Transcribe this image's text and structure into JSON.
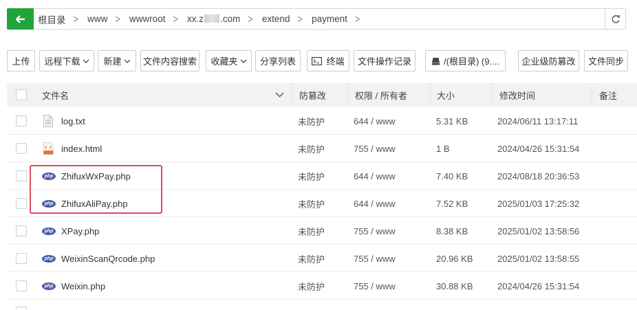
{
  "breadcrumb": {
    "items": [
      "根目录",
      "www",
      "wwwroot",
      "xx.z",
      "extend",
      "payment"
    ],
    "domain_prefix": "xx.z",
    "domain_suffix": ".com"
  },
  "toolbar": {
    "upload": "上传",
    "remote_download": "远程下载",
    "new": "新建",
    "content_search": "文件内容搜索",
    "favorites": "收藏夹",
    "share_list": "分享列表",
    "terminal": "终端",
    "operation_log": "文件操作记录",
    "disk": "/(根目录) (9....",
    "tamper_proof": "企业级防篡改",
    "file_sync": "文件同步"
  },
  "table": {
    "headers": {
      "name": "文件名",
      "protection": "防篡改",
      "permission": "权限 / 所有者",
      "size": "大小",
      "modified": "修改时间",
      "note": "备注"
    },
    "rows": [
      {
        "icon": "txt-file-icon",
        "name": "log.txt",
        "protection": "未防护",
        "permission": "644 / www",
        "size": "5.31 KB",
        "modified": "2024/06/11 13:17:11"
      },
      {
        "icon": "html-file-icon",
        "name": "index.html",
        "protection": "未防护",
        "permission": "755 / www",
        "size": "1 B",
        "modified": "2024/04/26 15:31:54"
      },
      {
        "icon": "php-file-icon",
        "name": "ZhifuxWxPay.php",
        "protection": "未防护",
        "permission": "644 / www",
        "size": "7.40 KB",
        "modified": "2024/08/18 20:36:53"
      },
      {
        "icon": "php-file-icon",
        "name": "ZhifuxAliPay.php",
        "protection": "未防护",
        "permission": "644 / www",
        "size": "7.52 KB",
        "modified": "2025/01/03 17:25:32"
      },
      {
        "icon": "php-file-icon",
        "name": "XPay.php",
        "protection": "未防护",
        "permission": "755 / www",
        "size": "8.38 KB",
        "modified": "2025/01/02 13:58:56"
      },
      {
        "icon": "php-file-icon",
        "name": "WeixinScanQrcode.php",
        "protection": "未防护",
        "permission": "755 / www",
        "size": "20.96 KB",
        "modified": "2025/01/02 13:58:55"
      },
      {
        "icon": "php-file-icon",
        "name": "Weixin.php",
        "protection": "未防护",
        "permission": "755 / www",
        "size": "30.88 KB",
        "modified": "2024/04/26 15:31:54"
      }
    ]
  },
  "icons": {
    "php_label": "php",
    "html_label": "HTML"
  },
  "colors": {
    "accent_green": "#20a53a",
    "highlight_red": "#e0475d",
    "php_blue": "#4c5aa6"
  }
}
